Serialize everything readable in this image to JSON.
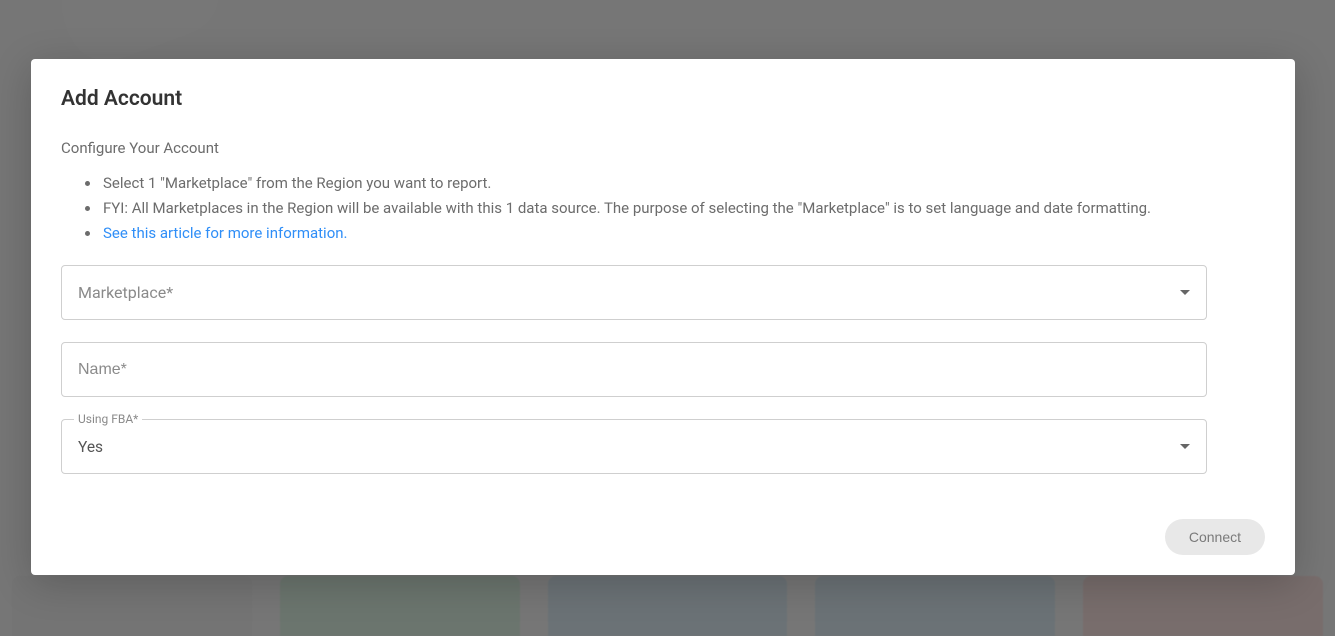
{
  "modal": {
    "title": "Add Account",
    "subtitle": "Configure Your Account",
    "bullets": [
      "Select 1 \"Marketplace\" from the Region you want to report.",
      "FYI: All Marketplaces in the Region will be available with this 1 data source. The purpose of selecting the \"Marketplace\" is to set language and date formatting."
    ],
    "link_text": "See this article for more information.",
    "fields": {
      "marketplace": {
        "label": "Marketplace*"
      },
      "name": {
        "placeholder": "Name*"
      },
      "using_fba": {
        "float_label": "Using FBA*",
        "value": "Yes"
      }
    },
    "connect_button": "Connect"
  }
}
